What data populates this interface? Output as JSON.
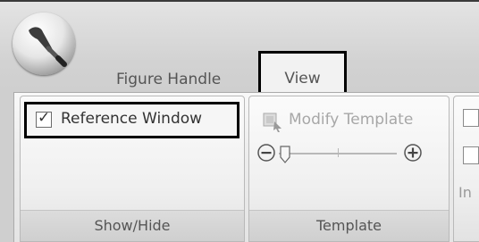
{
  "tabs": [
    {
      "label": "Figure Handle"
    },
    {
      "label": "View"
    }
  ],
  "groups": {
    "show_hide": {
      "label": "Show/Hide",
      "reference_window": {
        "label": "Reference Window",
        "checked": true
      }
    },
    "template": {
      "label": "Template",
      "modify_template": {
        "label": "Modify Template"
      },
      "zoom": {
        "level": 0
      }
    },
    "next_group": {
      "label_partial": "In"
    }
  },
  "icons": {
    "app_button": "paintbrush-icon",
    "modify_template": "modify-template-icon",
    "zoom_out": "zoom-out-icon",
    "zoom_in": "zoom-in-icon",
    "slider_thumb": "slider-thumb-icon"
  },
  "colors": {
    "ribbon_bg": "#f0f0f0",
    "highlight_border": "#000000",
    "disabled_text": "#a7a7a7"
  }
}
